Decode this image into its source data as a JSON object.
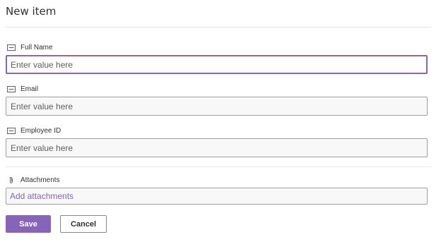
{
  "form": {
    "title": "New item",
    "fields": [
      {
        "label": "Full Name",
        "icon": "text-field-icon",
        "value": "",
        "placeholder": "Enter value here"
      },
      {
        "label": "Email",
        "icon": "text-field-icon",
        "value": "",
        "placeholder": "Enter value here"
      },
      {
        "label": "Employee ID",
        "icon": "text-field-icon",
        "value": "",
        "placeholder": "Enter value here"
      }
    ],
    "attachments": {
      "label": "Attachments",
      "icon": "paperclip-icon",
      "link": "Add attachments"
    },
    "save_label": "Save",
    "cancel_label": "Cancel"
  },
  "colors": {
    "accent": "#8764b8",
    "border": "#a19f9d",
    "field_bg": "#f8f8f8"
  }
}
